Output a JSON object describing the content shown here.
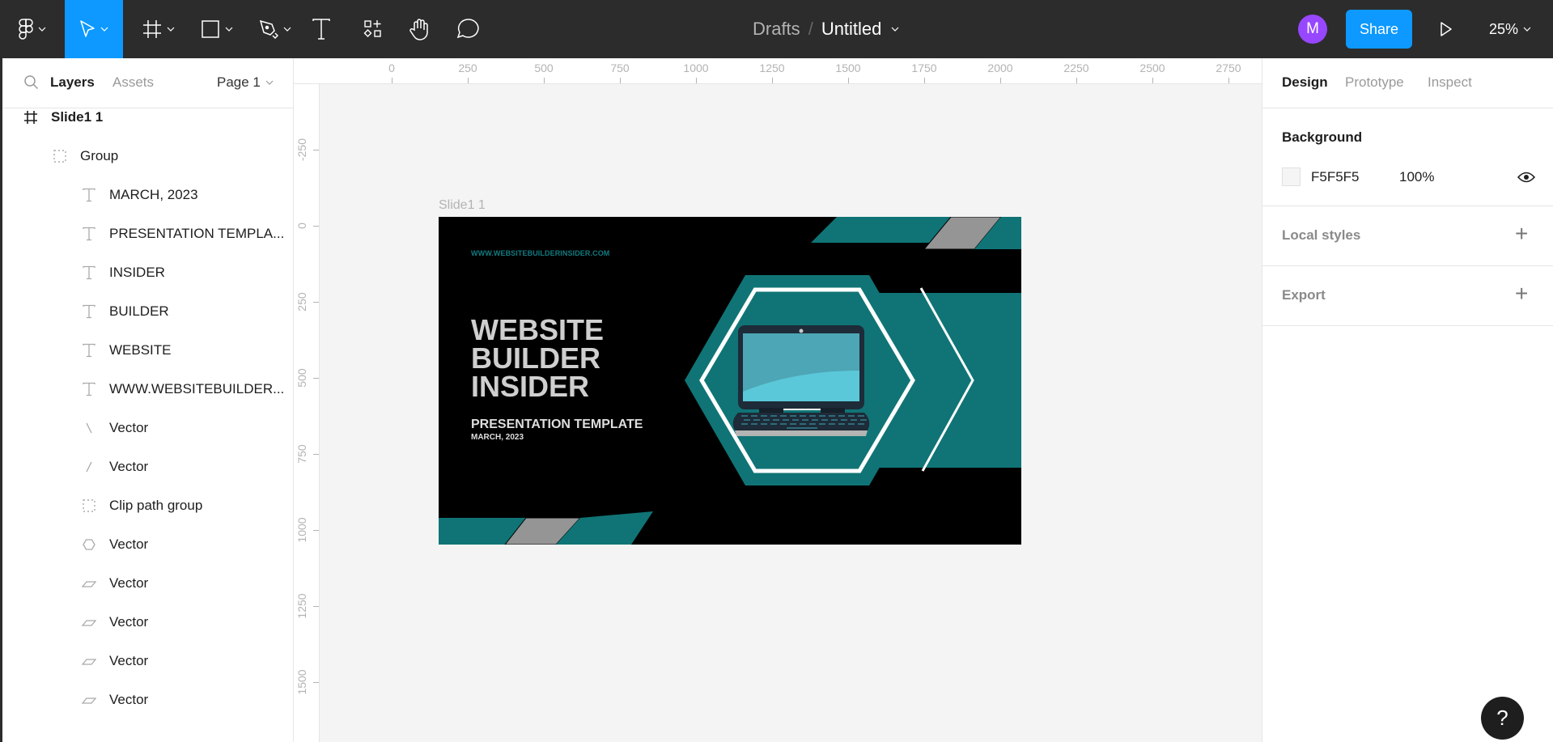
{
  "toolbar": {
    "tools": [
      {
        "name": "main-menu",
        "icon": "figma-logo-icon",
        "has_dropdown": true
      },
      {
        "name": "move",
        "icon": "move-cursor-icon",
        "has_dropdown": true,
        "active": true
      },
      {
        "name": "frame",
        "icon": "frame-hash-icon",
        "has_dropdown": true
      },
      {
        "name": "rectangle",
        "icon": "rectangle-icon",
        "has_dropdown": true
      },
      {
        "name": "pen",
        "icon": "pen-icon",
        "has_dropdown": true
      },
      {
        "name": "text",
        "icon": "text-icon",
        "has_dropdown": false
      },
      {
        "name": "resources",
        "icon": "resources-icon",
        "has_dropdown": false
      },
      {
        "name": "hand",
        "icon": "hand-icon",
        "has_dropdown": false
      },
      {
        "name": "comment",
        "icon": "comment-icon",
        "has_dropdown": false
      }
    ],
    "breadcrumb_root": "Drafts",
    "breadcrumb_sep": "/",
    "file_name": "Untitled",
    "avatar_initial": "M",
    "share_label": "Share",
    "zoom_level": "25%",
    "accent_color": "#0d99ff",
    "avatar_color": "#9747ff"
  },
  "left_panel": {
    "tabs": {
      "layers": "Layers",
      "assets": "Assets"
    },
    "page_selector": "Page 1",
    "layers": [
      {
        "label": "Slide1 1",
        "type": "frame",
        "depth": 0
      },
      {
        "label": "Group",
        "type": "group",
        "depth": 1
      },
      {
        "label": "MARCH, 2023",
        "type": "text",
        "depth": 2
      },
      {
        "label": "PRESENTATION TEMPLA...",
        "type": "text",
        "depth": 2
      },
      {
        "label": "INSIDER",
        "type": "text",
        "depth": 2
      },
      {
        "label": "BUILDER",
        "type": "text",
        "depth": 2
      },
      {
        "label": "WEBSITE",
        "type": "text",
        "depth": 2
      },
      {
        "label": "WWW.WEBSITEBUILDER...",
        "type": "text",
        "depth": 2
      },
      {
        "label": "Vector",
        "type": "line-back",
        "depth": 2
      },
      {
        "label": "Vector",
        "type": "line-fwd",
        "depth": 2
      },
      {
        "label": "Clip path group",
        "type": "group",
        "depth": 2
      },
      {
        "label": "Vector",
        "type": "hexagon",
        "depth": 2
      },
      {
        "label": "Vector",
        "type": "parallelogram",
        "depth": 2
      },
      {
        "label": "Vector",
        "type": "parallelogram",
        "depth": 2
      },
      {
        "label": "Vector",
        "type": "parallelogram",
        "depth": 2
      },
      {
        "label": "Vector",
        "type": "parallelogram",
        "depth": 2
      }
    ]
  },
  "rulers": {
    "horizontal": [
      "0",
      "250",
      "500",
      "750",
      "1000",
      "1250",
      "1500",
      "1750",
      "2000",
      "2250",
      "2500",
      "2750"
    ],
    "vertical": [
      "-250",
      "0",
      "250",
      "500",
      "750",
      "1000",
      "1250",
      "1500"
    ]
  },
  "canvas": {
    "frame_label": "Slide1 1",
    "slide": {
      "url_text": "WWW.WEBSITEBUILDERINSIDER.COM",
      "title_lines": [
        "WEBSITE",
        "BUILDER",
        "INSIDER"
      ],
      "subtitle": "PRESENTATION TEMPLATE",
      "date": "MARCH, 2023",
      "colors": {
        "background": "#000000",
        "teal": "#107476",
        "gray": "#959595",
        "title": "#cfcfcf",
        "screen_light": "#5ac8d8",
        "screen_dark": "#4da6b5",
        "laptop_body": "#1e2b38"
      }
    }
  },
  "right_panel": {
    "tabs": [
      "Design",
      "Prototype",
      "Inspect"
    ],
    "active_tab": "Design",
    "background": {
      "title": "Background",
      "hex": "F5F5F5",
      "opacity": "100%",
      "visible": true
    },
    "local_styles": "Local styles",
    "export": "Export"
  },
  "help_label": "?"
}
